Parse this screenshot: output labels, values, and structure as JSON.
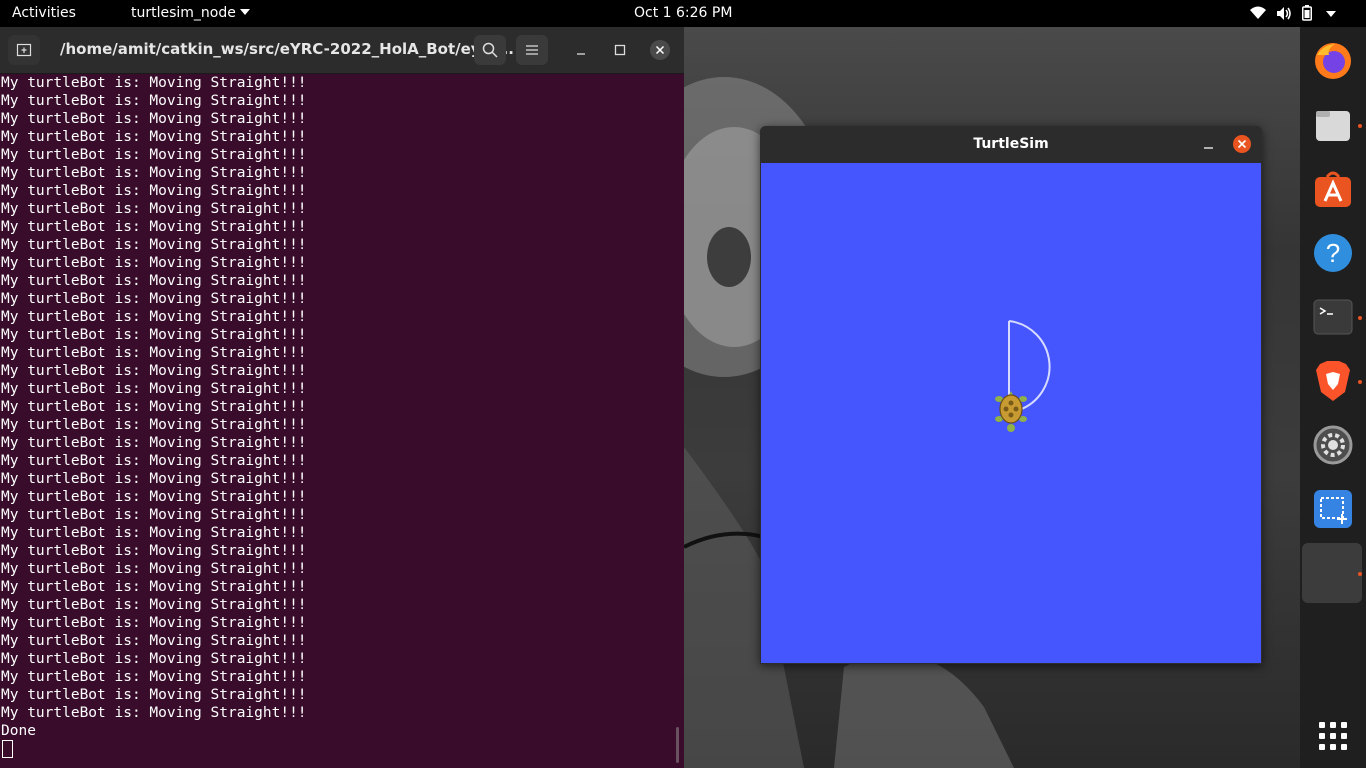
{
  "topbar": {
    "activities": "Activities",
    "app_menu": "turtlesim_node",
    "clock": "Oct 1   6:26 PM"
  },
  "terminal": {
    "title": "/home/amit/catkin_ws/src/eYRC-2022_HolA_Bot/eyrc...",
    "lines": [
      "My turtleBot is: Moving Straight!!!",
      "My turtleBot is: Moving Straight!!!",
      "My turtleBot is: Moving Straight!!!",
      "My turtleBot is: Moving Straight!!!",
      "My turtleBot is: Moving Straight!!!",
      "My turtleBot is: Moving Straight!!!",
      "My turtleBot is: Moving Straight!!!",
      "My turtleBot is: Moving Straight!!!",
      "My turtleBot is: Moving Straight!!!",
      "My turtleBot is: Moving Straight!!!",
      "My turtleBot is: Moving Straight!!!",
      "My turtleBot is: Moving Straight!!!",
      "My turtleBot is: Moving Straight!!!",
      "My turtleBot is: Moving Straight!!!",
      "My turtleBot is: Moving Straight!!!",
      "My turtleBot is: Moving Straight!!!",
      "My turtleBot is: Moving Straight!!!",
      "My turtleBot is: Moving Straight!!!",
      "My turtleBot is: Moving Straight!!!",
      "My turtleBot is: Moving Straight!!!",
      "My turtleBot is: Moving Straight!!!",
      "My turtleBot is: Moving Straight!!!",
      "My turtleBot is: Moving Straight!!!",
      "My turtleBot is: Moving Straight!!!",
      "My turtleBot is: Moving Straight!!!",
      "My turtleBot is: Moving Straight!!!",
      "My turtleBot is: Moving Straight!!!",
      "My turtleBot is: Moving Straight!!!",
      "My turtleBot is: Moving Straight!!!",
      "My turtleBot is: Moving Straight!!!",
      "My turtleBot is: Moving Straight!!!",
      "My turtleBot is: Moving Straight!!!",
      "My turtleBot is: Moving Straight!!!",
      "My turtleBot is: Moving Straight!!!",
      "My turtleBot is: Moving Straight!!!",
      "My turtleBot is: Moving Straight!!!",
      "Done"
    ]
  },
  "turtlesim": {
    "title": "TurtleSim",
    "background_color": "#4556ff"
  },
  "dock": {
    "items": [
      "firefox-icon",
      "files-icon",
      "software-store-icon",
      "help-icon",
      "terminal-icon",
      "brave-browser-icon",
      "settings-icon",
      "screenshot-icon",
      "active-app-icon"
    ],
    "running_indicator_color": "#e95420"
  }
}
